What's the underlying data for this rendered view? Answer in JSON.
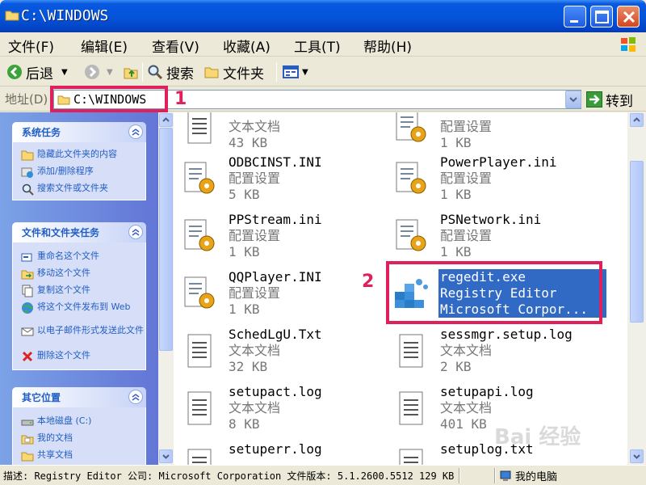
{
  "window": {
    "title": "C:\\WINDOWS",
    "buttons": {
      "minimize": "minimize",
      "maximize": "maximize",
      "close": "close"
    }
  },
  "menu": [
    "文件(F)",
    "编辑(E)",
    "查看(V)",
    "收藏(A)",
    "工具(T)",
    "帮助(H)"
  ],
  "toolbar": {
    "back": "后退",
    "search": "搜索",
    "folders": "文件夹"
  },
  "address": {
    "label": "地址(D)",
    "value": "C:\\WINDOWS",
    "go": "转到"
  },
  "annotations": {
    "address_marker": "1",
    "file_marker": "2"
  },
  "annotation_color": "#E0205A",
  "left_pane": {
    "system_tasks": {
      "title": "系统任务",
      "items": [
        {
          "label": "隐藏此文件夹的内容",
          "icon": "folder-hide-icon"
        },
        {
          "label": "添加/删除程序",
          "icon": "add-remove-programs-icon"
        },
        {
          "label": "搜索文件或文件夹",
          "icon": "search-icon"
        }
      ]
    },
    "file_tasks": {
      "title": "文件和文件夹任务",
      "items": [
        {
          "label": "重命名这个文件",
          "icon": "rename-icon"
        },
        {
          "label": "移动这个文件",
          "icon": "move-icon"
        },
        {
          "label": "复制这个文件",
          "icon": "copy-icon"
        },
        {
          "label": "将这个文件发布到 Web",
          "icon": "publish-web-icon"
        },
        {
          "label": "以电子邮件形式发送此文件",
          "icon": "email-icon"
        },
        {
          "label": "删除这个文件",
          "icon": "delete-icon"
        }
      ]
    },
    "other_places": {
      "title": "其它位置",
      "items": [
        {
          "label": "本地磁盘 (C:)",
          "icon": "local-disk-icon"
        },
        {
          "label": "我的文档",
          "icon": "my-documents-icon"
        },
        {
          "label": "共享文档",
          "icon": "shared-documents-icon"
        }
      ]
    }
  },
  "files": [
    {
      "name": "",
      "type": "文本文档",
      "size": "43 KB",
      "icon": "text-document-icon"
    },
    {
      "name": "",
      "type": "配置设置",
      "size": "1 KB",
      "icon": "config-settings-icon"
    },
    {
      "name": "ODBCINST.INI",
      "type": "配置设置",
      "size": "5 KB",
      "icon": "config-settings-icon"
    },
    {
      "name": "PowerPlayer.ini",
      "type": "配置设置",
      "size": "1 KB",
      "icon": "config-settings-icon"
    },
    {
      "name": "PPStream.ini",
      "type": "配置设置",
      "size": "1 KB",
      "icon": "config-settings-icon"
    },
    {
      "name": "PSNetwork.ini",
      "type": "配置设置",
      "size": "1 KB",
      "icon": "config-settings-icon"
    },
    {
      "name": "QQPlayer.INI",
      "type": "配置设置",
      "size": "1 KB",
      "icon": "config-settings-icon"
    },
    {
      "name": "regedit.exe",
      "type": "Registry Editor",
      "size": "Microsoft Corpor...",
      "icon": "registry-editor-icon",
      "selected": true
    },
    {
      "name": "SchedLgU.Txt",
      "type": "文本文档",
      "size": "32 KB",
      "icon": "text-document-icon"
    },
    {
      "name": "sessmgr.setup.log",
      "type": "文本文档",
      "size": "2 KB",
      "icon": "text-document-icon"
    },
    {
      "name": "setupact.log",
      "type": "文本文档",
      "size": "8 KB",
      "icon": "text-document-icon"
    },
    {
      "name": "setupapi.log",
      "type": "文本文档",
      "size": "401 KB",
      "icon": "text-document-icon"
    },
    {
      "name": "setuperr.log",
      "type": "",
      "size": "",
      "icon": "text-document-icon"
    },
    {
      "name": "setuplog.txt",
      "type": "",
      "size": "",
      "icon": "text-document-icon"
    }
  ],
  "status": {
    "description": "描述: Registry Editor 公司: Microsoft Corporation 文件版本: 5.1.2600.5512 129 KB",
    "location": "我的电脑"
  },
  "watermark": "Bai 经验"
}
